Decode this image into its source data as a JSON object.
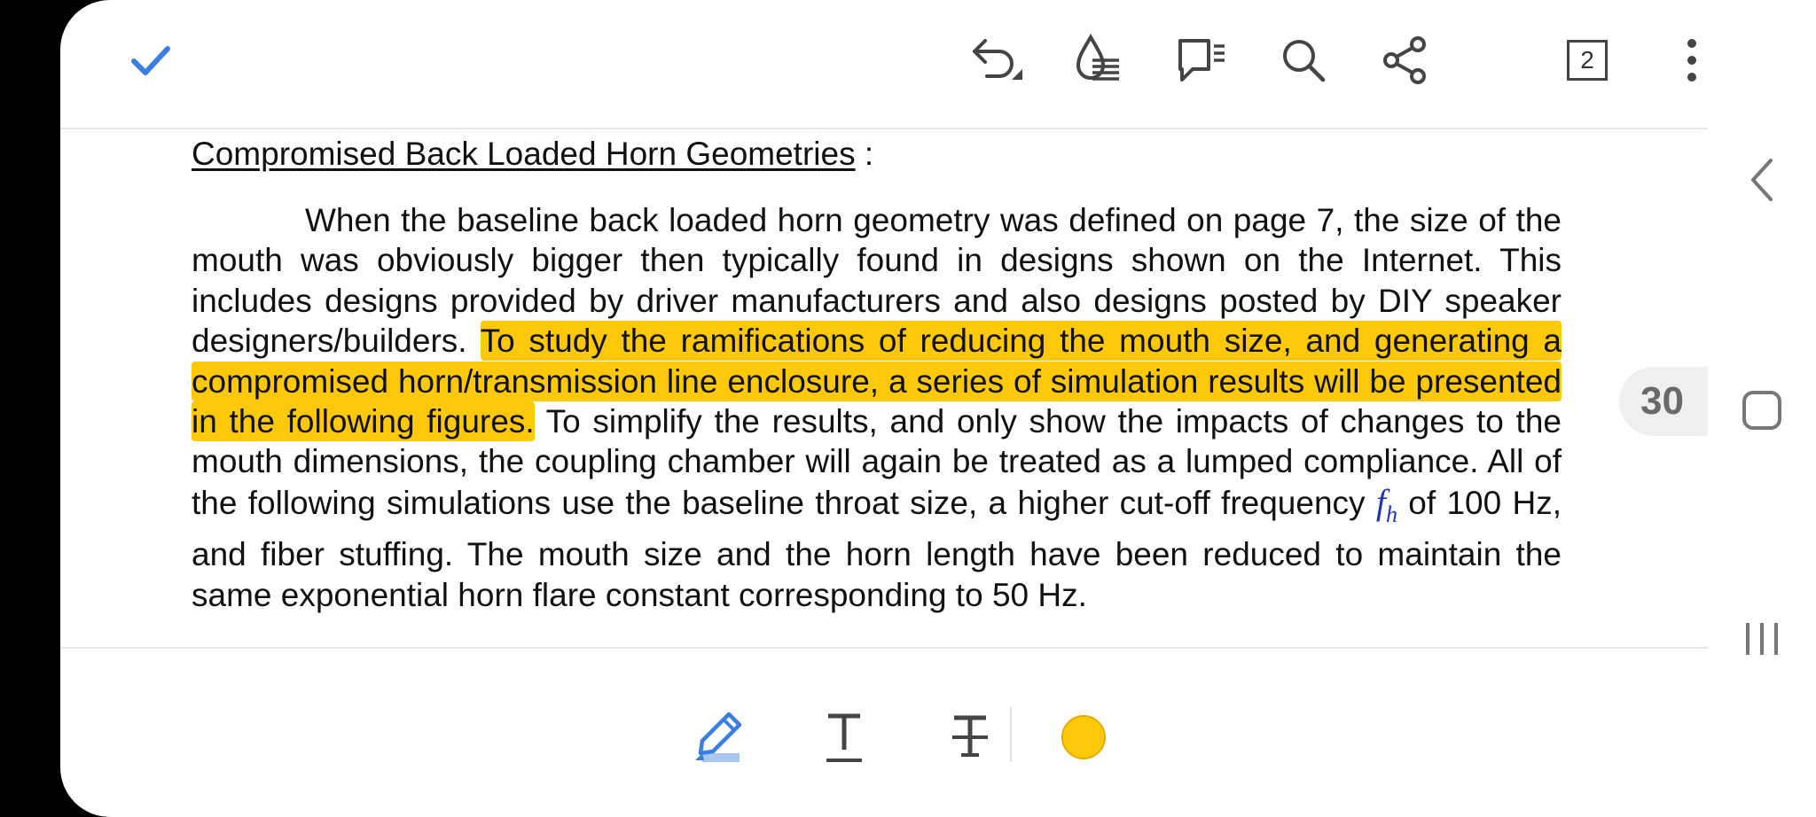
{
  "toolbar": {
    "done_icon": "checkmark-icon",
    "undo_icon": "undo-icon",
    "ink_icon": "ink-drop-icon",
    "comments_icon": "comment-list-icon",
    "search_icon": "search-icon",
    "share_icon": "share-icon",
    "page_count": "2",
    "more_icon": "more-vertical-icon",
    "accent_color": "#3b7de0"
  },
  "document": {
    "heading": "Compromised Back Loaded Horn Geometries",
    "heading_suffix": " :",
    "para_before": "When the baseline back loaded horn geometry was defined on page 7, the size of the mouth was obviously bigger then typically found in designs shown on the Internet. This includes designs provided by driver manufacturers and also designs posted by DIY speaker designers/builders. ",
    "highlighted": "To study the ramifications of reducing the mouth size, and generating a compromised horn/transmission line enclosure, a series of simulation results will be presented in the following figures.",
    "para_after_1": " To simplify the results, and only show the impacts of changes to the mouth dimensions, the coupling chamber will again be treated as a lumped compliance. All of the following simulations use the baseline throat size, a higher cut-off frequency ",
    "math_symbol": "f",
    "math_subscript": "h",
    "para_after_2": " of 100 Hz, and fiber stuffing. The mouth size and the horn length have been reduced to maintain the same exponential horn flare constant corresponding to 50 Hz.",
    "highlight_color": "#ffc90a"
  },
  "page_indicator": "30",
  "bottom_toolbar": {
    "highlighter_icon": "highlighter-pen-icon",
    "underline_icon": "underline-text-icon",
    "strikethrough_icon": "strikethrough-text-icon",
    "color_picker": "color-picker-icon",
    "current_color": "#ffc90a"
  },
  "system_nav": {
    "back_icon": "back-chevron-icon",
    "home_icon": "home-square-icon",
    "recents_icon": "recents-icon"
  }
}
